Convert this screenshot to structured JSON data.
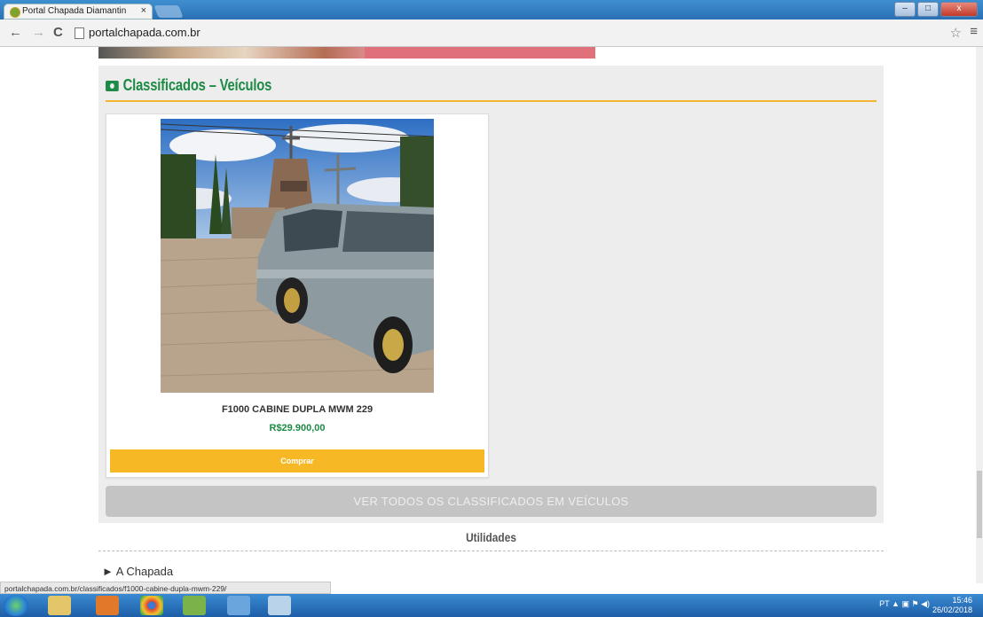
{
  "browser": {
    "tab_title": "Portal Chapada Diamantin",
    "tab_close": "×",
    "url": "portalchapada.com.br",
    "back_icon": "←",
    "forward_icon": "→",
    "reload_icon": "C",
    "star_icon": "☆",
    "menu_icon": "≡",
    "status_url": "portalchapada.com.br/classificados/f1000-cabine-dupla-mwm-229/"
  },
  "window_controls": {
    "minimize": "–",
    "maximize": "□",
    "close": "x"
  },
  "section": {
    "title": "Classificados – Veículos",
    "view_all": "VER TODOS OS CLASSIFICADOS EM VEÍCULOS"
  },
  "product": {
    "name": "F1000 CABINE DUPLA MWM 229",
    "price": "R$29.900,00",
    "buy_label": "Comprar"
  },
  "utilidades": {
    "title": "Utilidades",
    "items": [
      {
        "label": "A Chapada"
      }
    ]
  },
  "taskbar": {
    "language": "PT",
    "time": "15:46",
    "date": "26/02/2018"
  },
  "colors": {
    "accent_green": "#1d8a45",
    "accent_yellow": "#f6b824",
    "section_bg": "#ededed"
  }
}
